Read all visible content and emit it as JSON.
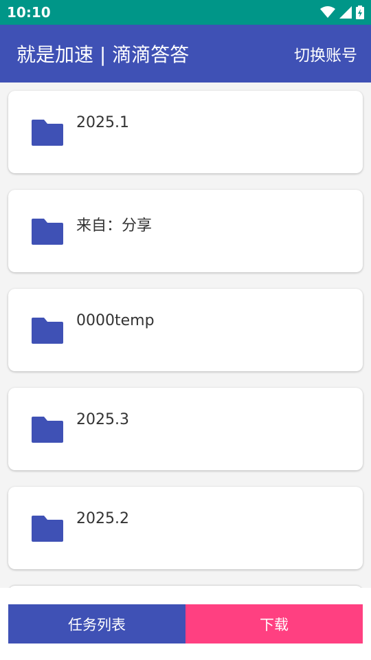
{
  "status_bar": {
    "time": "10:10"
  },
  "app_bar": {
    "title": "就是加速 | 滴滴答答",
    "action_label": "切换账号"
  },
  "folders": [
    {
      "name": "2025.1"
    },
    {
      "name": "来自：分享"
    },
    {
      "name": "0000temp"
    },
    {
      "name": "2025.3"
    },
    {
      "name": "2025.2"
    }
  ],
  "bottom_actions": {
    "tasks_label": "任务列表",
    "download_label": "下载"
  },
  "colors": {
    "status_bar": "#009688",
    "primary": "#3f51b5",
    "accent": "#ff4081"
  }
}
